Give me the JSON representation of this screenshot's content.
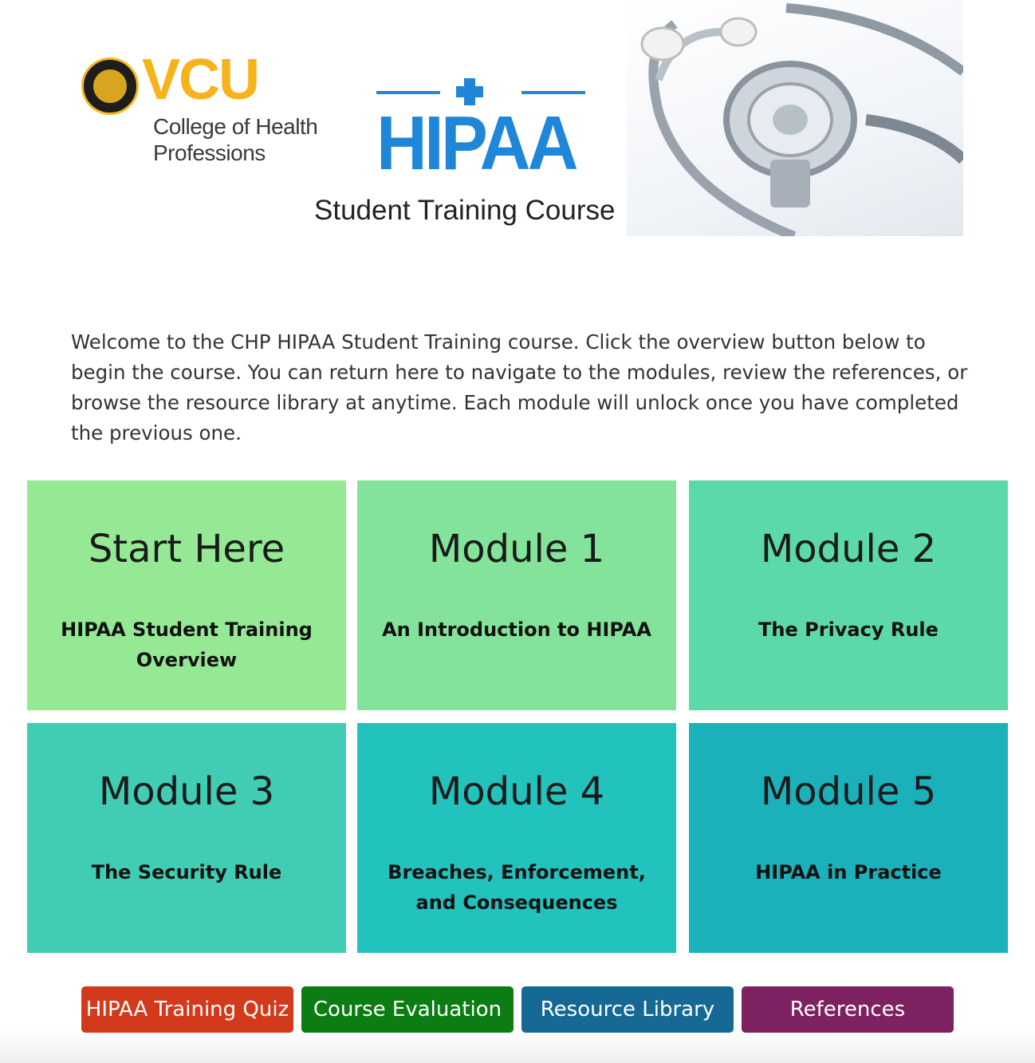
{
  "banner": {
    "vcu_logo": "VCU",
    "vcu_subtitle_line1": "College of Health",
    "vcu_subtitle_line2": "Professions",
    "hipaa_logo": "HIPAA",
    "course_subtitle": "Student Training Course",
    "seal_icon": "vcu-seal-icon",
    "stethoscope_image": "stethoscope-image"
  },
  "intro": {
    "text": "Welcome to the CHP HIPAA Student Training course. Click the overview button below to begin the course. You can return here to navigate to the modules, review the references, or browse the resource library at anytime. Each module will unlock once you have completed the previous one."
  },
  "tiles": [
    {
      "title": "Start Here",
      "subtitle": "HIPAA Student Training Overview",
      "color": "#95e995"
    },
    {
      "title": "Module 1",
      "subtitle": "An Introduction to HIPAA",
      "color": "#84e39b"
    },
    {
      "title": "Module 2",
      "subtitle": "The Privacy Rule",
      "color": "#5cd9a9"
    },
    {
      "title": "Module 3",
      "subtitle": "The Security Rule",
      "color": "#40cdb4"
    },
    {
      "title": "Module 4",
      "subtitle": "Breaches, Enforcement, and Consequences",
      "color": "#22c2bd"
    },
    {
      "title": "Module 5",
      "subtitle": "HIPAA in Practice",
      "color": "#1bb1bb"
    }
  ],
  "buttons": [
    {
      "label": "HIPAA Training Quiz",
      "color": "#d33a1b"
    },
    {
      "label": "Course Evaluation",
      "color": "#0b7d12"
    },
    {
      "label": "Resource Library",
      "color": "#156994"
    },
    {
      "label": "References",
      "color": "#7d2160"
    }
  ]
}
